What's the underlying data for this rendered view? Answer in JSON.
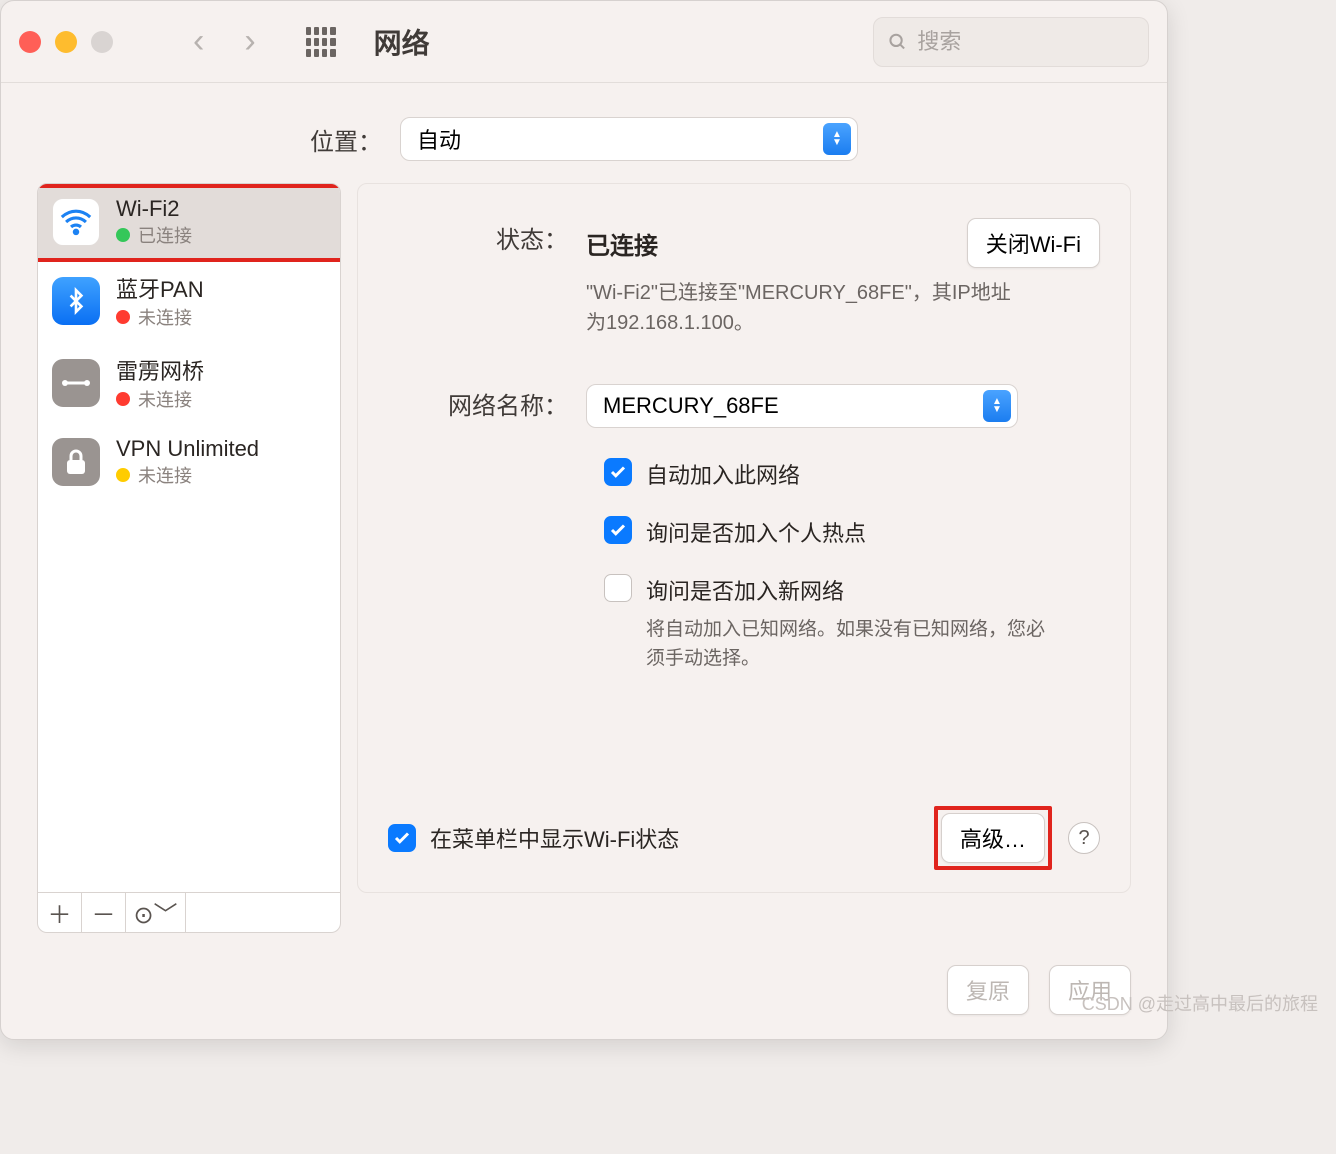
{
  "window": {
    "title": "网络"
  },
  "search": {
    "placeholder": "搜索"
  },
  "location": {
    "label": "位置：",
    "value": "自动"
  },
  "sidebar": {
    "items": [
      {
        "name": "Wi-Fi2",
        "status": "已连接",
        "dot": "green"
      },
      {
        "name": "蓝牙PAN",
        "status": "未连接",
        "dot": "red"
      },
      {
        "name": "雷雳网桥",
        "status": "未连接",
        "dot": "red"
      },
      {
        "name": "VPN Unlimited",
        "status": "未连接",
        "dot": "yellow"
      }
    ]
  },
  "status": {
    "label": "状态：",
    "value": "已连接",
    "button": "关闭Wi-Fi",
    "desc": "\"Wi-Fi2\"已连接至\"MERCURY_68FE\"，其IP地址为192.168.1.100。"
  },
  "network": {
    "label": "网络名称：",
    "value": "MERCURY_68FE"
  },
  "checks": {
    "autojoin": "自动加入此网络",
    "ask_hotspot": "询问是否加入个人热点",
    "ask_new": "询问是否加入新网络",
    "ask_new_desc": "将自动加入已知网络。如果没有已知网络，您必须手动选择。"
  },
  "footer": {
    "menubar": "在菜单栏中显示Wi-Fi状态",
    "advanced": "高级…"
  },
  "buttons": {
    "revert": "复原",
    "apply": "应用"
  },
  "watermark": "CSDN @走过高中最后的旅程"
}
